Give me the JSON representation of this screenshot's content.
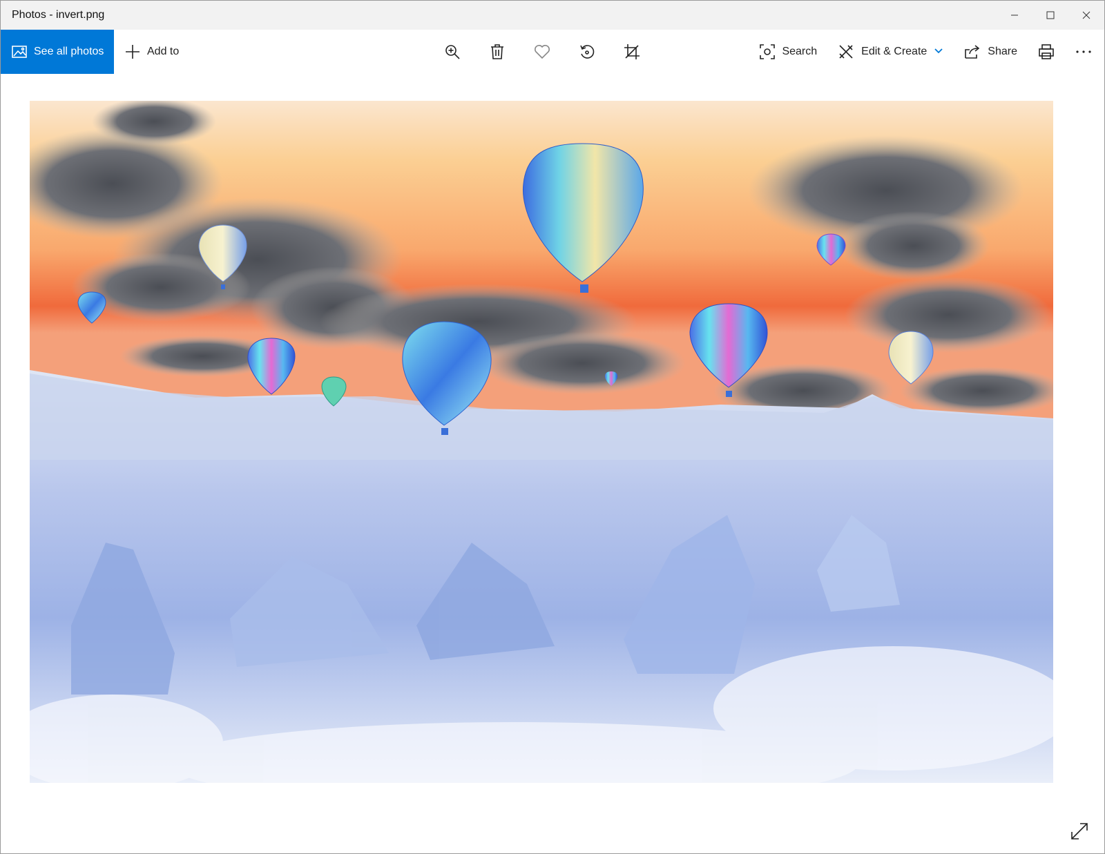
{
  "window": {
    "title": "Photos - invert.png",
    "controls": [
      "minimize-icon",
      "maximize-icon",
      "close-icon"
    ]
  },
  "toolbar": {
    "see_all_label": "See all photos",
    "add_to_label": "Add to",
    "center_icons": [
      "zoom-in-icon",
      "delete-icon",
      "favorite-icon",
      "rotate-icon",
      "crop-icon"
    ],
    "search_label": "Search",
    "edit_create_label": "Edit & Create",
    "share_label": "Share",
    "print_icon": "print-icon",
    "more_icon": "more-icon"
  },
  "viewer": {
    "image_name": "invert.png",
    "fullscreen_icon": "expand-icon"
  },
  "colors": {
    "accent": "#0078d7",
    "titlebar": "#f2f2f2",
    "background": "#ffffff"
  }
}
